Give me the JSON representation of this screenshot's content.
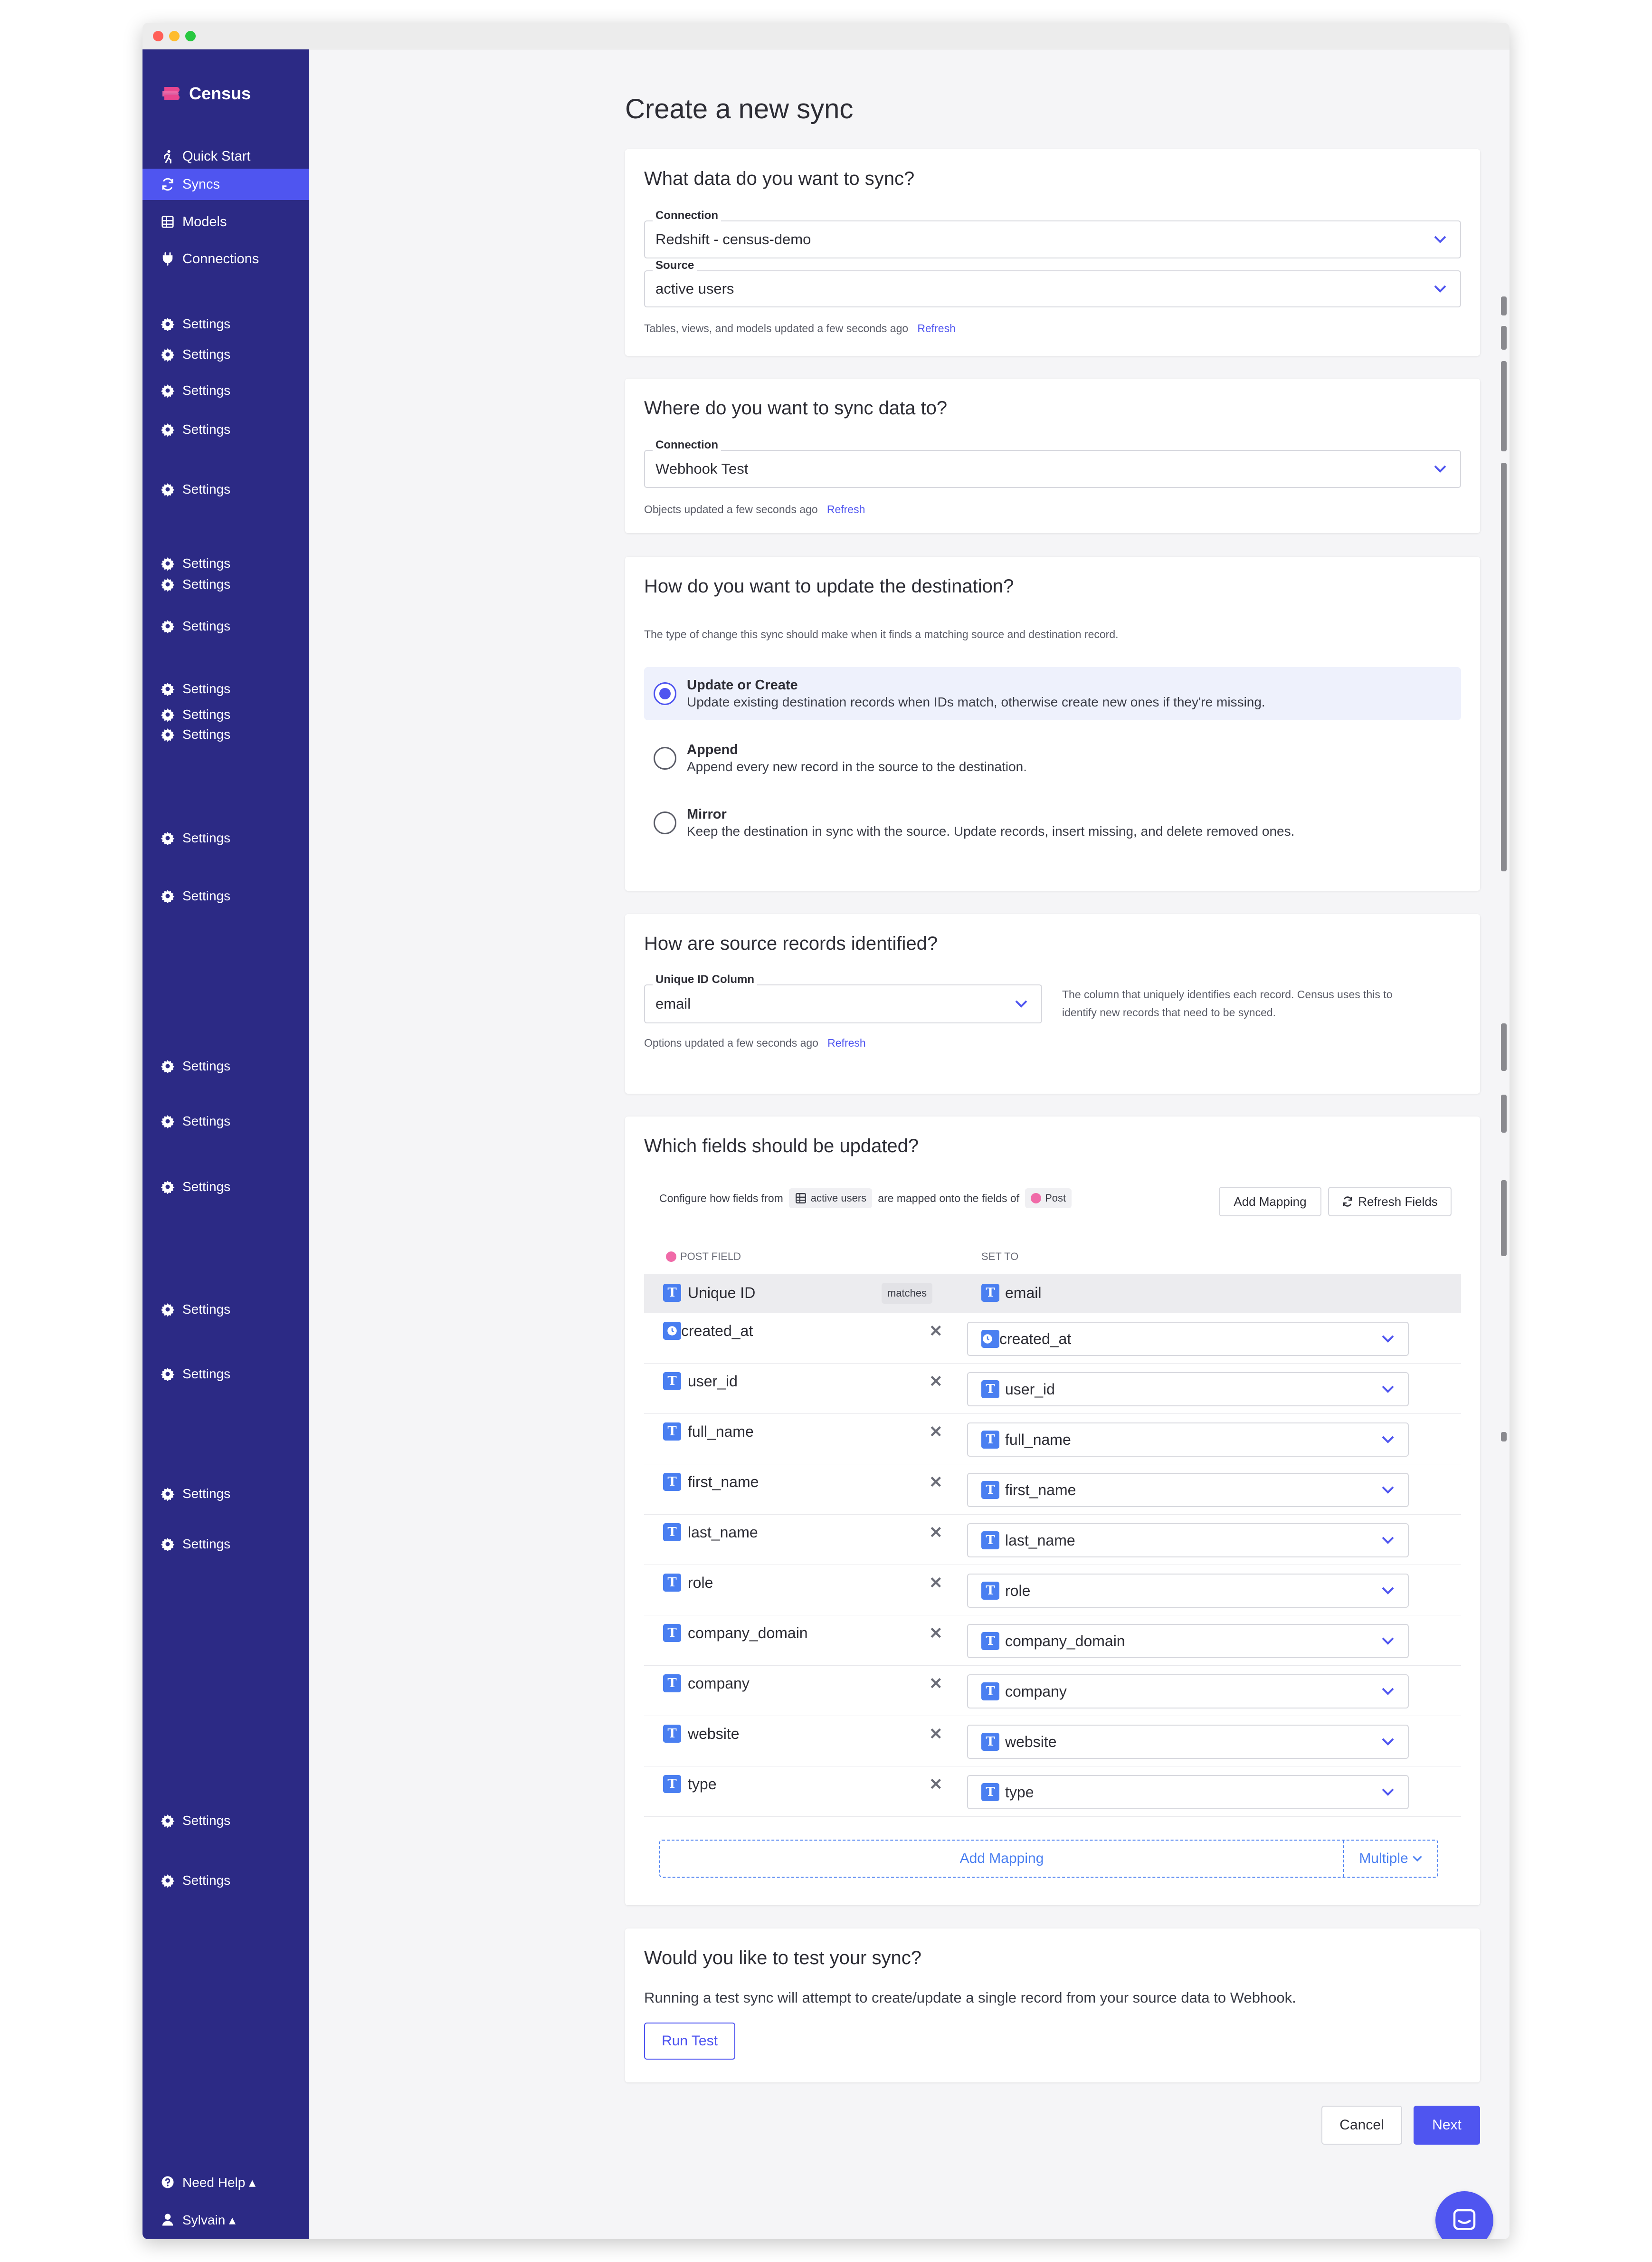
{
  "brand": "Census",
  "colors": {
    "sidebar": "#2c2a85",
    "active": "#4f55f0",
    "accent": "#4f55f0",
    "type_badge": "#4a7ff1"
  },
  "nav": {
    "quick_start": "Quick Start",
    "syncs": "Syncs",
    "models": "Models",
    "connections": "Connections",
    "settings": "Settings",
    "need_help": "Need Help ▴",
    "user": "Sylvain ▴"
  },
  "page_title": "Create a new sync",
  "source_card": {
    "title": "What data do you want to sync?",
    "connection_label": "Connection",
    "connection_value": "Redshift - census-demo",
    "source_label": "Source",
    "source_value": "active users",
    "hint": "Tables, views, and models updated a few seconds ago",
    "refresh": "Refresh"
  },
  "dest_card": {
    "title": "Where do you want to sync data to?",
    "connection_label": "Connection",
    "connection_value": "Webhook Test",
    "hint": "Objects updated a few seconds ago",
    "refresh": "Refresh"
  },
  "mode_card": {
    "title": "How do you want to update the destination?",
    "description": "The type of change this sync should make when it finds a matching source and destination record.",
    "options": [
      {
        "title": "Update or Create",
        "desc": "Update existing destination records when IDs match, otherwise create new ones if they're missing."
      },
      {
        "title": "Append",
        "desc": "Append every new record in the source to the destination."
      },
      {
        "title": "Mirror",
        "desc": "Keep the destination in sync with the source. Update records, insert missing, and delete removed ones."
      }
    ]
  },
  "id_card": {
    "title": "How are source records identified?",
    "label": "Unique ID Column",
    "value": "email",
    "side_text_1": "The column that uniquely identifies each record. Census uses this to",
    "side_text_2": "identify new records that need to be synced.",
    "hint": "Options updated a few seconds ago",
    "refresh": "Refresh"
  },
  "fields_card": {
    "title": "Which fields should be updated?",
    "config_a": "Configure how fields from",
    "source_chip": "active users",
    "config_b": "are mapped onto the fields of",
    "dest_chip": "Post",
    "add_mapping": "Add Mapping",
    "refresh_fields": "Refresh Fields",
    "col_left": "POST FIELD",
    "col_right": "SET TO",
    "id_row": {
      "left": "Unique ID",
      "matches": "matches",
      "right": "email"
    },
    "rows": [
      {
        "field": "created_at",
        "value": "created_at"
      },
      {
        "field": "user_id",
        "value": "user_id"
      },
      {
        "field": "full_name",
        "value": "full_name"
      },
      {
        "field": "first_name",
        "value": "first_name"
      },
      {
        "field": "last_name",
        "value": "last_name"
      },
      {
        "field": "role",
        "value": "role"
      },
      {
        "field": "company_domain",
        "value": "company_domain"
      },
      {
        "field": "company",
        "value": "company"
      },
      {
        "field": "website",
        "value": "website"
      },
      {
        "field": "type",
        "value": "type"
      }
    ],
    "add_mapping_bottom": "Add Mapping",
    "multiple": "Multiple"
  },
  "test_card": {
    "title": "Would you like to test your sync?",
    "description": "Running a test sync will attempt to create/update a single record from your source data to Webhook.",
    "run_test": "Run Test"
  },
  "footer": {
    "cancel": "Cancel",
    "next": "Next"
  }
}
